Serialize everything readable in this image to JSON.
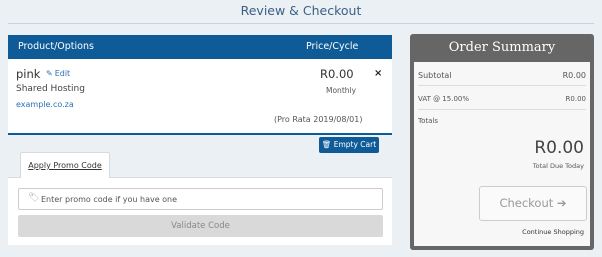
{
  "page": {
    "title": "Review & Checkout"
  },
  "cart": {
    "header": {
      "product_col": "Product/Options",
      "price_col": "Price/Cycle"
    },
    "item": {
      "name": "pink",
      "edit_label": "Edit",
      "group": "Shared Hosting",
      "domain": "example.co.za",
      "price": "R0.00",
      "cycle": "Monthly",
      "remove_symbol": "×",
      "prorata": "(Pro Rata 2019/08/01)"
    },
    "empty_cart_label": "Empty Cart"
  },
  "promo": {
    "tab_label": "Apply Promo Code",
    "placeholder": "Enter promo code if you have one",
    "validate_label": "Validate Code"
  },
  "summary": {
    "title": "Order Summary",
    "subtotal_label": "Subtotal",
    "subtotal_value": "R0.00",
    "vat_label": "VAT @ 15.00%",
    "vat_value": "R0.00",
    "totals_label": "Totals",
    "total_value": "R0.00",
    "total_due_label": "Total Due Today",
    "checkout_label": "Checkout",
    "continue_label": "Continue Shopping"
  },
  "icons": {
    "edit": "pencil-icon",
    "remove": "close-icon",
    "empty_cart": "trash-icon",
    "promo": "tag-icon",
    "checkout": "arrow-right-icon"
  },
  "colors": {
    "primary": "#0e5b98",
    "summary_header": "#666666",
    "background": "#eaf0f4",
    "link": "#2a72b5"
  }
}
